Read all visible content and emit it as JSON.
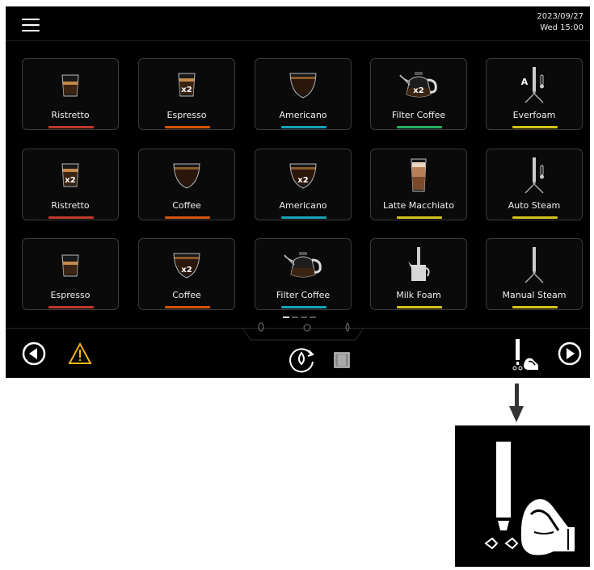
{
  "header": {
    "menu_icon": "hamburger-menu-icon",
    "date": "2023/09/27",
    "day_time": "Wed  15:00"
  },
  "tiles": [
    {
      "label": "Ristretto",
      "bar_color": "#c0392b",
      "icon": "small-glass-icon"
    },
    {
      "label": "Espresso",
      "bar_color": "#d35400",
      "icon": "glass-x2-icon",
      "badge": "x2"
    },
    {
      "label": "Americano",
      "bar_color": "#17a2b8",
      "icon": "cup-icon"
    },
    {
      "label": "Filter Coffee",
      "bar_color": "#27ae60",
      "icon": "teapot-x2-icon",
      "badge": "x2"
    },
    {
      "label": "Everfoam",
      "bar_color": "#d4c21a",
      "icon": "steam-wand-auto-icon",
      "badge": "A"
    },
    {
      "label": "Ristretto",
      "bar_color": "#c0392b",
      "icon": "glass-x2-icon",
      "badge": "x2"
    },
    {
      "label": "Coffee",
      "bar_color": "#d35400",
      "icon": "cup-icon"
    },
    {
      "label": "Americano",
      "bar_color": "#17a2b8",
      "icon": "cup-x2-icon",
      "badge": "x2"
    },
    {
      "label": "Latte Macchiato",
      "bar_color": "#d4c21a",
      "icon": "tall-glass-icon"
    },
    {
      "label": "Auto Steam",
      "bar_color": "#d4c21a",
      "icon": "steam-wand-thermo-icon"
    },
    {
      "label": "Espresso",
      "bar_color": "#c0392b",
      "icon": "small-glass-icon"
    },
    {
      "label": "Coffee",
      "bar_color": "#d35400",
      "icon": "cup-x2-icon",
      "badge": "x2"
    },
    {
      "label": "Filter Coffee",
      "bar_color": "#17a2b8",
      "icon": "teapot-icon"
    },
    {
      "label": "Milk Foam",
      "bar_color": "#d4c21a",
      "icon": "milk-pitcher-icon"
    },
    {
      "label": "Manual Steam",
      "bar_color": "#d4c21a",
      "icon": "steam-wand-icon"
    }
  ],
  "pager": {
    "pages": 4,
    "current": 1
  },
  "footer": {
    "prev_icon": "previous-arrow-icon",
    "warning_icon": "warning-triangle-icon",
    "rinse_icon": "rinse-cycle-icon",
    "grounds_icon": "grounds-container-icon",
    "steam_hand_icon": "steam-wand-hand-icon",
    "next_icon": "next-arrow-icon"
  },
  "colors": {
    "accent_warning": "#f0b419",
    "background": "#000000"
  }
}
